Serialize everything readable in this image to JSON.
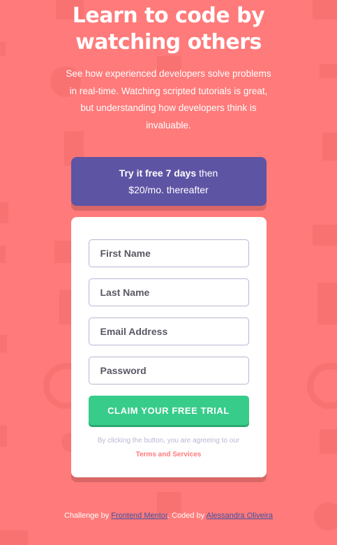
{
  "hero": {
    "headline": "Learn to code by watching others",
    "intro": "See how experienced developers solve problems in real-time. Watching scripted tutorials is great, but understanding how developers think is invaluable."
  },
  "offer": {
    "bold": "Try it free 7 days",
    "rest_1": " then",
    "rest_2": "$20/mo. thereafter"
  },
  "form": {
    "first_name_placeholder": "First Name",
    "last_name_placeholder": "Last Name",
    "email_placeholder": "Email Address",
    "password_placeholder": "Password",
    "submit_label": "CLAIM YOUR FREE TRIAL",
    "terms_prefix": "By clicking the button, you are agreeing to our ",
    "terms_link": "Terms and Services"
  },
  "footer": {
    "challenge_prefix": "Challenge by ",
    "challenge_link": "Frontend Mentor",
    "coded_prefix": ". Coded by ",
    "coded_link": "Alessandra Oliveira"
  },
  "colors": {
    "background": "#ff7a7a",
    "offer": "#5e54a4",
    "submit": "#38cc8b",
    "link": "#3e52a3"
  }
}
